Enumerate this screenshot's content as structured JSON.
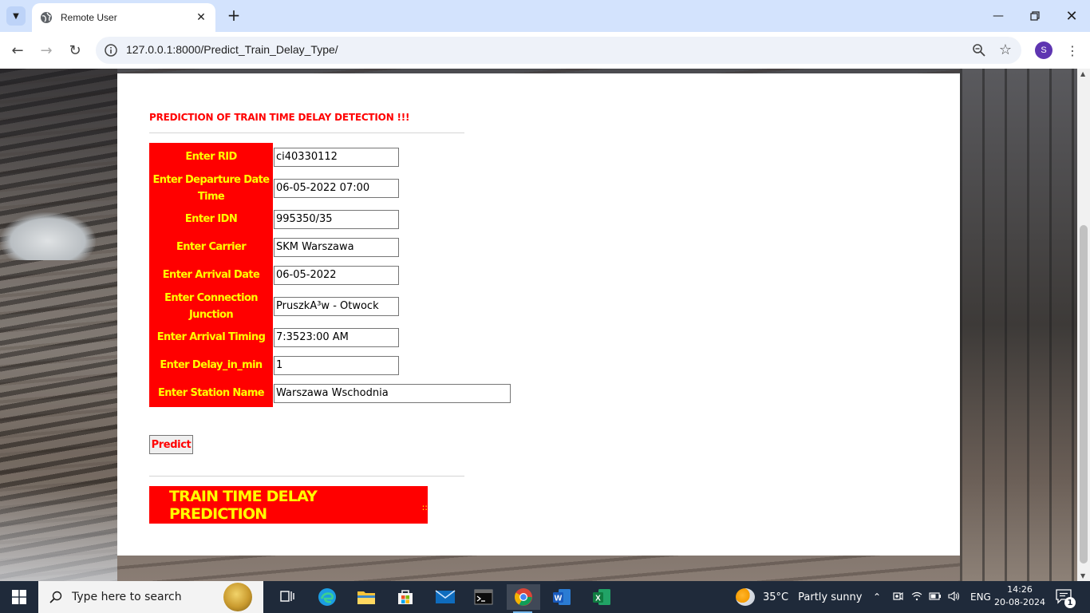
{
  "browser": {
    "tab_title": "Remote User",
    "url": "127.0.0.1:8000/Predict_Train_Delay_Type/",
    "profile_initial": "S"
  },
  "page": {
    "heading": "PREDICTION OF TRAIN TIME DELAY DETECTION !!!",
    "fields": [
      {
        "label": "Enter RID",
        "value": "ci40330112"
      },
      {
        "label": "Enter Departure Date Time",
        "value": "06-05-2022 07:00"
      },
      {
        "label": "Enter IDN",
        "value": "995350/35"
      },
      {
        "label": "Enter Carrier",
        "value": "SKM Warszawa"
      },
      {
        "label": "Enter Arrival Date",
        "value": "06-05-2022"
      },
      {
        "label": "Enter Connection Junction",
        "value": "PruszkÃ³w - Otwock"
      },
      {
        "label": "Enter Arrival Timing",
        "value": "7:3523:00 AM"
      },
      {
        "label": "Enter Delay_in_min",
        "value": "1"
      },
      {
        "label": "Enter Station Name",
        "value": "Warszawa Wschodnia"
      }
    ],
    "predict_label": "Predict",
    "result_title": "TRAIN TIME DELAY PREDICTION",
    "result_suffix": "::"
  },
  "colors": {
    "accent_red": "#ff0000",
    "label_yellow": "#ffff00"
  },
  "taskbar": {
    "search_placeholder": "Type here to search",
    "weather_temp": "35°C",
    "weather_text": "Partly sunny",
    "language": "ENG",
    "time": "14:26",
    "date": "20-08-2024",
    "notification_count": "1",
    "icons": [
      "task-view-icon",
      "edge-icon",
      "file-explorer-icon",
      "store-icon",
      "mail-icon",
      "terminal-icon",
      "chrome-icon",
      "word-icon",
      "excel-icon"
    ]
  }
}
